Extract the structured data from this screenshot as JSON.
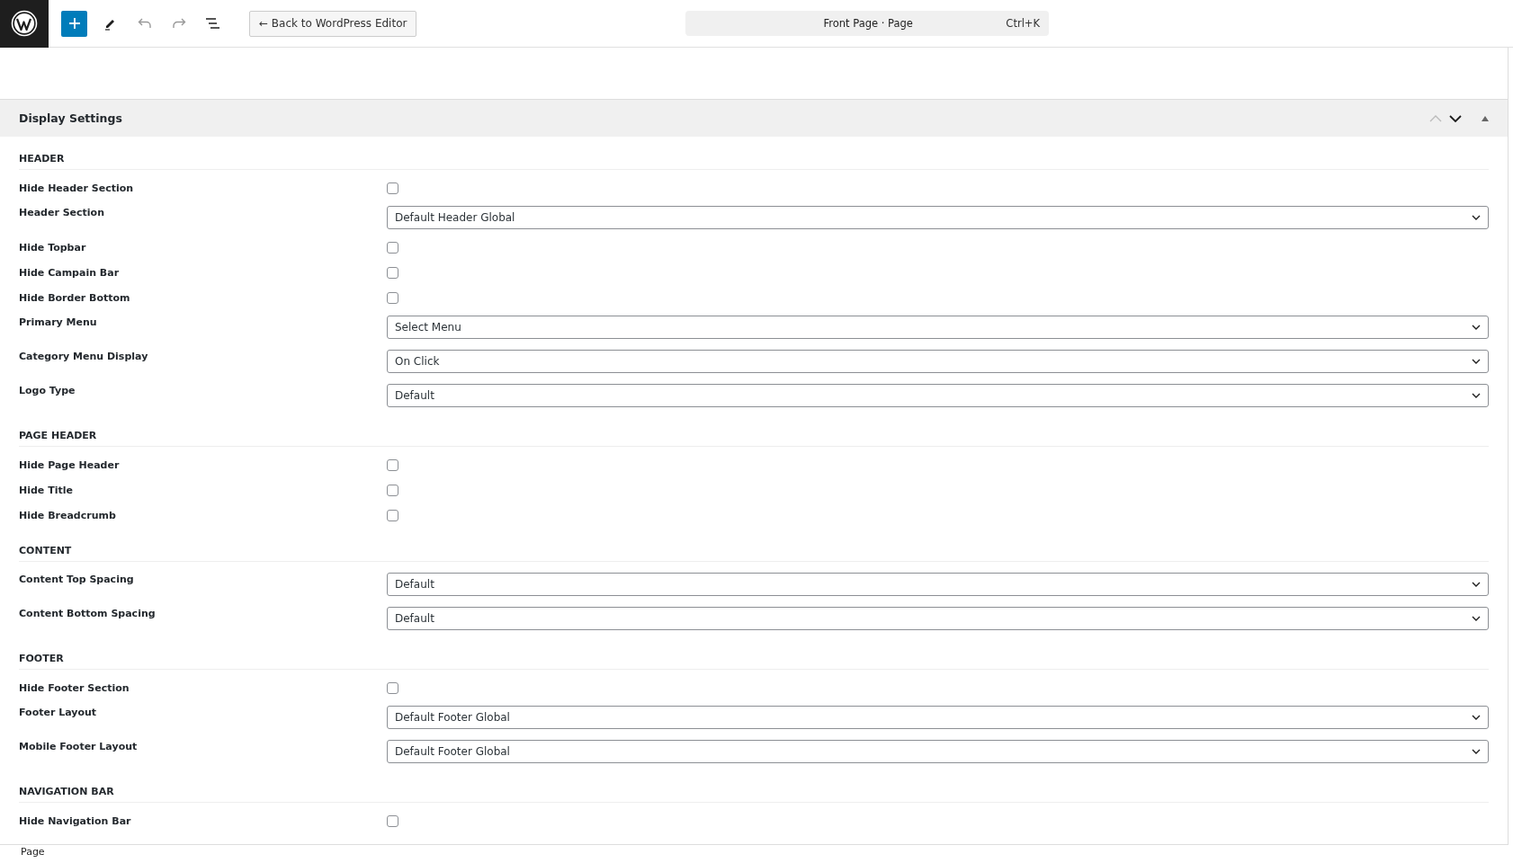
{
  "toolbar": {
    "back_button": "← Back to WordPress Editor",
    "command_bar": {
      "title": "Front Page · Page",
      "shortcut": "Ctrl+K"
    }
  },
  "panel": {
    "title": "Display Settings",
    "expanded": true,
    "sections": [
      {
        "heading": "HEADER",
        "fields": [
          {
            "kind": "checkbox",
            "label": "Hide Header Section",
            "checked": false
          },
          {
            "kind": "select",
            "label": "Header Section",
            "value": "Default Header Global"
          },
          {
            "kind": "checkbox",
            "label": "Hide Topbar",
            "checked": false
          },
          {
            "kind": "checkbox",
            "label": "Hide Campain Bar",
            "checked": false
          },
          {
            "kind": "checkbox",
            "label": "Hide Border Bottom",
            "checked": false
          },
          {
            "kind": "select",
            "label": "Primary Menu",
            "value": "Select Menu"
          },
          {
            "kind": "select",
            "label": "Category Menu Display",
            "value": "On Click"
          },
          {
            "kind": "select",
            "label": "Logo Type",
            "value": "Default"
          }
        ]
      },
      {
        "heading": "PAGE HEADER",
        "fields": [
          {
            "kind": "checkbox",
            "label": "Hide Page Header",
            "checked": false
          },
          {
            "kind": "checkbox",
            "label": "Hide Title",
            "checked": false
          },
          {
            "kind": "checkbox",
            "label": "Hide Breadcrumb",
            "checked": false
          }
        ]
      },
      {
        "heading": "CONTENT",
        "fields": [
          {
            "kind": "select",
            "label": "Content Top Spacing",
            "value": "Default"
          },
          {
            "kind": "select",
            "label": "Content Bottom Spacing",
            "value": "Default"
          }
        ]
      },
      {
        "heading": "FOOTER",
        "fields": [
          {
            "kind": "checkbox",
            "label": "Hide Footer Section",
            "checked": false
          },
          {
            "kind": "select",
            "label": "Footer Layout",
            "value": "Default Footer Global"
          },
          {
            "kind": "select",
            "label": "Mobile Footer Layout",
            "value": "Default Footer Global"
          }
        ]
      },
      {
        "heading": "NAVIGATION BAR",
        "fields": [
          {
            "kind": "checkbox",
            "label": "Hide Navigation Bar",
            "checked": false
          }
        ]
      }
    ]
  },
  "breadcrumb": "Page"
}
